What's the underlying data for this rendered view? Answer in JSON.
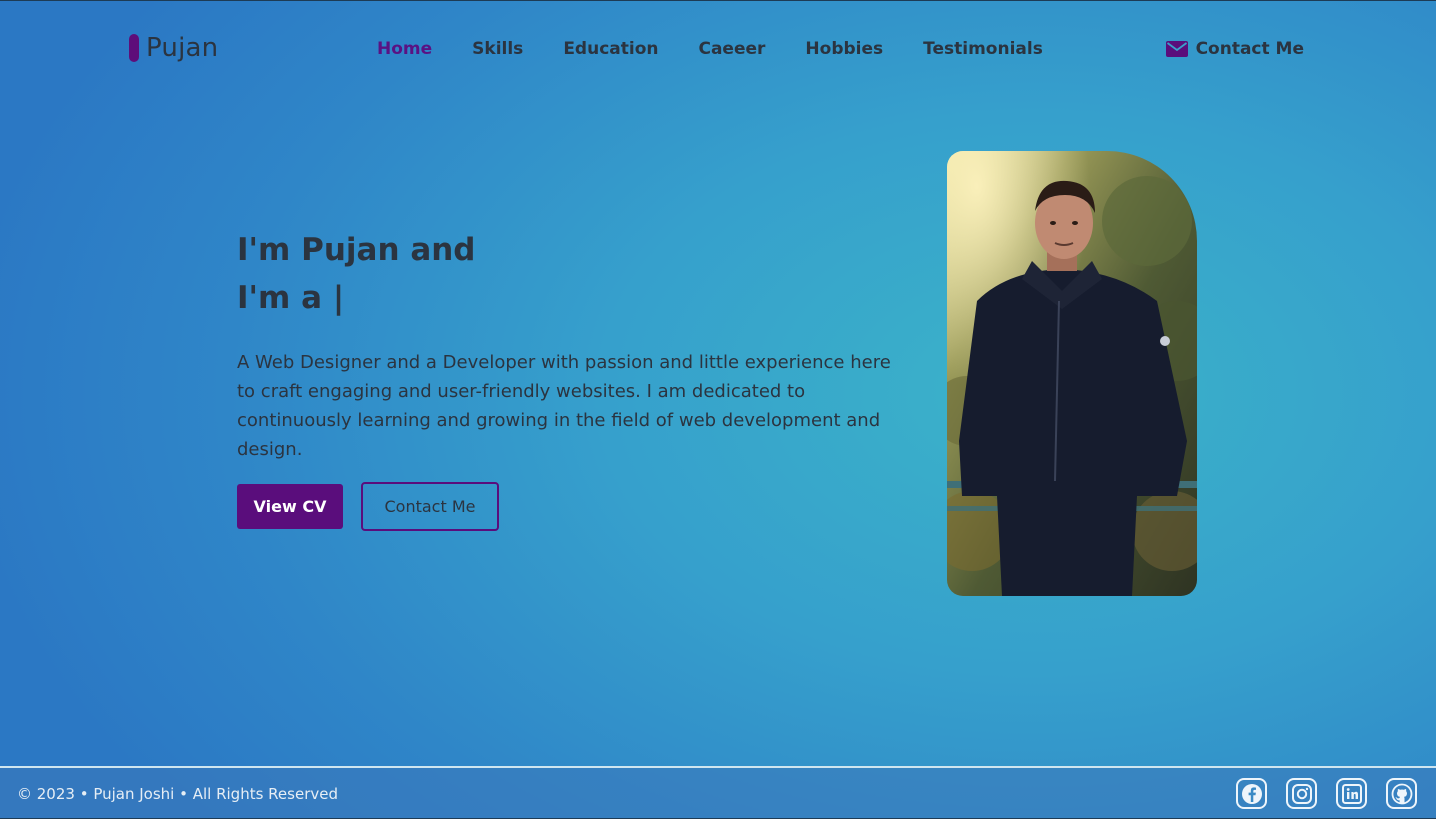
{
  "brand": {
    "name": "Pujan",
    "accent": "#5e0e7a"
  },
  "nav": {
    "items": [
      {
        "label": "Home",
        "active": true
      },
      {
        "label": "Skills"
      },
      {
        "label": "Education"
      },
      {
        "label": "Caeeer"
      },
      {
        "label": "Hobbies"
      },
      {
        "label": "Testimonials"
      }
    ],
    "contact_label": "Contact Me"
  },
  "hero": {
    "line1": "I'm Pujan and",
    "line2": "I'm a |",
    "description": "A Web Designer and a Developer with passion and little experience here to craft engaging and user-friendly websites. I am dedicated to continuously learning and growing in the field of web development and design.",
    "cv_button": "View CV",
    "contact_button": "Contact Me"
  },
  "footer": {
    "copyright": "© 2023 • Pujan Joshi • All Rights Reserved",
    "socials": [
      "facebook-icon",
      "instagram-icon",
      "linkedin-icon",
      "github-icon"
    ]
  },
  "colors": {
    "text": "#2b3440",
    "active_nav": "#5a1283",
    "button": "#5a0d7c"
  }
}
